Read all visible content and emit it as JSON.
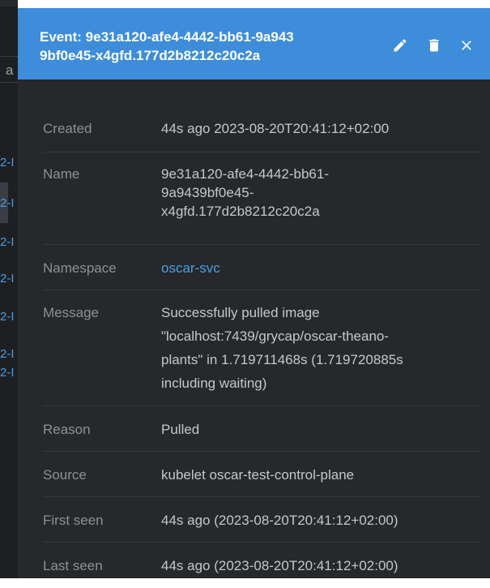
{
  "background": {
    "search_fragment": "a",
    "link_fragments": [
      "2-I",
      "2-I",
      "2-I",
      "2-I",
      "2-I",
      "2-I",
      "2-I"
    ]
  },
  "drawer": {
    "title_line1": "Event: 9e31a120-afe4-4442-bb61-9a943",
    "title_line2": "9bf0e45-x4gfd.177d2b8212c20c2a",
    "actions": {
      "edit": "edit-icon",
      "delete": "delete-icon",
      "close": "close-icon"
    },
    "accent_color": "#3d8ddb"
  },
  "details": {
    "created_label": "Created",
    "created_value": "44s ago 2023-08-20T20:41:12+02:00",
    "name_label": "Name",
    "name_line1": "9e31a120-afe4-4442-bb61-",
    "name_line2": "9a9439bf0e45-",
    "name_line3": "x4gfd.177d2b8212c20c2a",
    "namespace_label": "Namespace",
    "namespace_value": "oscar-svc",
    "message_label": "Message",
    "message_line1": "Successfully pulled image",
    "message_line2": "\"localhost:7439/grycap/oscar-theano-",
    "message_line3": "plants\" in 1.719711468s (1.719720885s",
    "message_line4": "including waiting)",
    "reason_label": "Reason",
    "reason_value": "Pulled",
    "source_label": "Source",
    "source_value": "kubelet oscar-test-control-plane",
    "first_seen_label": "First seen",
    "first_seen_value": "44s ago (2023-08-20T20:41:12+02:00)",
    "last_seen_label": "Last seen",
    "last_seen_value": "44s ago (2023-08-20T20:41:12+02:00)"
  }
}
